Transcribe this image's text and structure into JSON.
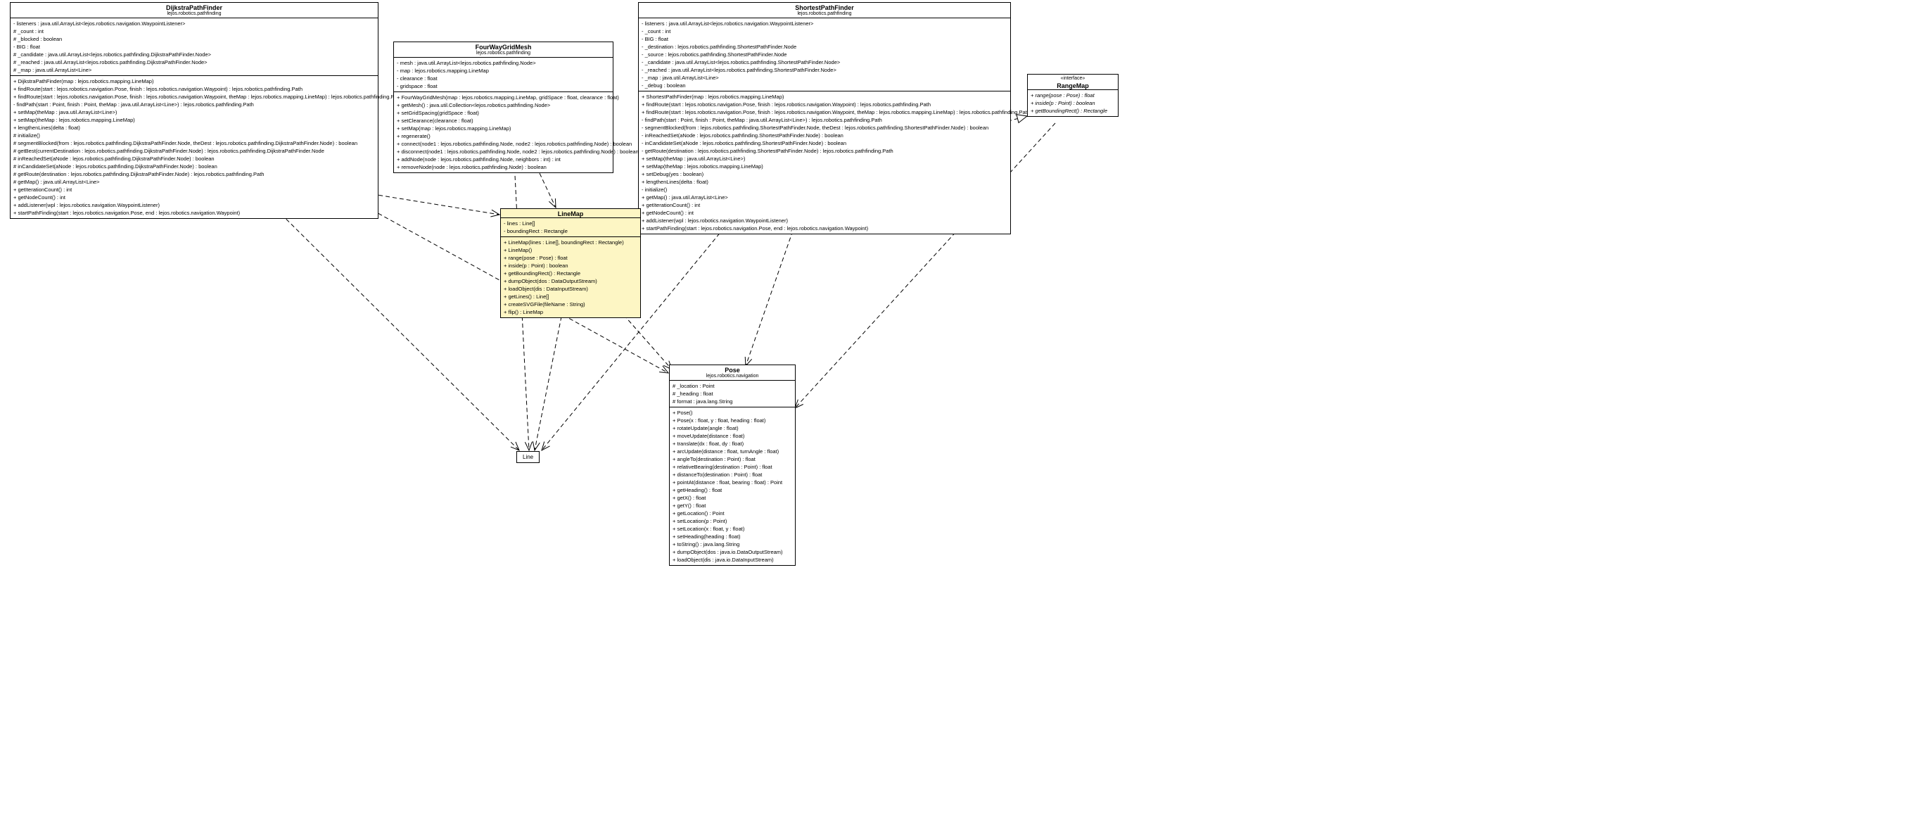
{
  "classes": {
    "dijkstra": {
      "name": "DijkstraPathFinder",
      "package": "lejos.robotics.pathfinding",
      "attrs": [
        "- listeners : java.util.ArrayList<lejos.robotics.navigation.WaypointListener>",
        "# _count : int",
        "# _blocked : boolean",
        "- BIG : float",
        "# _candidate : java.util.ArrayList<lejos.robotics.pathfinding.DijkstraPathFinder.Node>",
        "# _reached : java.util.ArrayList<lejos.robotics.pathfinding.DijkstraPathFinder.Node>",
        "# _map : java.util.ArrayList<Line>"
      ],
      "ops": [
        "+ DijkstraPathFinder(map : lejos.robotics.mapping.LineMap)",
        "+ findRoute(start : lejos.robotics.navigation.Pose, finish : lejos.robotics.navigation.Waypoint) : lejos.robotics.pathfinding.Path",
        "+ findRoute(start : lejos.robotics.navigation.Pose, finish : lejos.robotics.navigation.Waypoint, theMap : lejos.robotics.mapping.LineMap) : lejos.robotics.pathfinding.Path",
        "- findPath(start : Point, finish : Point, theMap : java.util.ArrayList<Line>) : lejos.robotics.pathfinding.Path",
        "+ setMap(theMap : java.util.ArrayList<Line>)",
        "+ setMap(theMap : lejos.robotics.mapping.LineMap)",
        "+ lengthenLines(delta : float)",
        "# initialize()",
        "# segmentBlocked(from : lejos.robotics.pathfinding.DijkstraPathFinder.Node, theDest : lejos.robotics.pathfinding.DijkstraPathFinder.Node) : boolean",
        "# getBest(currentDestination : lejos.robotics.pathfinding.DijkstraPathFinder.Node) : lejos.robotics.pathfinding.DijkstraPathFinder.Node",
        "# inReachedSet(aNode : lejos.robotics.pathfinding.DijkstraPathFinder.Node) : boolean",
        "# inCandidateSet(aNode : lejos.robotics.pathfinding.DijkstraPathFinder.Node) : boolean",
        "# getRoute(destination : lejos.robotics.pathfinding.DijkstraPathFinder.Node) : lejos.robotics.pathfinding.Path",
        "# getMap() : java.util.ArrayList<Line>",
        "+ getIterationCount() : int",
        "+ getNodeCount() : int",
        "+ addListener(wpl : lejos.robotics.navigation.WaypointListener)",
        "+ startPathFinding(start : lejos.robotics.navigation.Pose, end : lejos.robotics.navigation.Waypoint)"
      ]
    },
    "fourway": {
      "name": "FourWayGridMesh",
      "package": "lejos.robotics.pathfinding",
      "attrs": [
        "- mesh : java.util.ArrayList<lejos.robotics.pathfinding.Node>",
        "- map : lejos.robotics.mapping.LineMap",
        "- clearance : float",
        "- gridspace : float"
      ],
      "ops": [
        "+ FourWayGridMesh(map : lejos.robotics.mapping.LineMap, gridSpace : float, clearance : float)",
        "+ getMesh() : java.util.Collection<lejos.robotics.pathfinding.Node>",
        "+ setGridSpacing(gridSpace : float)",
        "+ setClearance(clearance : float)",
        "+ setMap(map : lejos.robotics.mapping.LineMap)",
        "+ regenerate()",
        "+ connect(node1 : lejos.robotics.pathfinding.Node, node2 : lejos.robotics.pathfinding.Node) : boolean",
        "+ disconnect(node1 : lejos.robotics.pathfinding.Node, node2 : lejos.robotics.pathfinding.Node) : boolean",
        "+ addNode(node : lejos.robotics.pathfinding.Node, neighbors : int) : int",
        "+ removeNode(node : lejos.robotics.pathfinding.Node) : boolean"
      ]
    },
    "shortest": {
      "name": "ShortestPathFinder",
      "package": "lejos.robotics.pathfinding",
      "attrs": [
        "- listeners : java.util.ArrayList<lejos.robotics.navigation.WaypointListener>",
        "- _count : int",
        "- BIG : float",
        "- _destination : lejos.robotics.pathfinding.ShortestPathFinder.Node",
        "- _source : lejos.robotics.pathfinding.ShortestPathFinder.Node",
        "- _candidate : java.util.ArrayList<lejos.robotics.pathfinding.ShortestPathFinder.Node>",
        "- _reached : java.util.ArrayList<lejos.robotics.pathfinding.ShortestPathFinder.Node>",
        "- _map : java.util.ArrayList<Line>",
        "- _debug : boolean"
      ],
      "ops": [
        "+ ShortestPathFinder(map : lejos.robotics.mapping.LineMap)",
        "+ findRoute(start : lejos.robotics.navigation.Pose, finish : lejos.robotics.navigation.Waypoint) : lejos.robotics.pathfinding.Path",
        "+ findRoute(start : lejos.robotics.navigation.Pose, finish : lejos.robotics.navigation.Waypoint, theMap : lejos.robotics.mapping.LineMap) : lejos.robotics.pathfinding.Path",
        "- findPath(start : Point, finish : Point, theMap : java.util.ArrayList<Line>) : lejos.robotics.pathfinding.Path",
        "- segmentBlocked(from : lejos.robotics.pathfinding.ShortestPathFinder.Node, theDest : lejos.robotics.pathfinding.ShortestPathFinder.Node) : boolean",
        "- inReachedSet(aNode : lejos.robotics.pathfinding.ShortestPathFinder.Node) : boolean",
        "- inCandidateSet(aNode : lejos.robotics.pathfinding.ShortestPathFinder.Node) : boolean",
        "- getRoute(destination : lejos.robotics.pathfinding.ShortestPathFinder.Node) : lejos.robotics.pathfinding.Path",
        "+ setMap(theMap : java.util.ArrayList<Line>)",
        "+ setMap(theMap : lejos.robotics.mapping.LineMap)",
        "+ setDebug(yes : boolean)",
        "+ lengthenLines(delta : float)",
        "- initialize()",
        "+ getMap() : java.util.ArrayList<Line>",
        "+ getIterationCount() : int",
        "+ getNodeCount() : int",
        "+ addListener(wpl : lejos.robotics.navigation.WaypointListener)",
        "+ startPathFinding(start : lejos.robotics.navigation.Pose, end : lejos.robotics.navigation.Waypoint)"
      ]
    },
    "rangemap": {
      "stereotype": "«interface»",
      "name": "RangeMap",
      "ops": [
        "+ range(pose : Pose) : float",
        "+ inside(p : Point) : boolean",
        "+ getBoundingRect() : Rectangle"
      ]
    },
    "linemap": {
      "name": "LineMap",
      "attrs": [
        "- lines : Line[]",
        "- boundingRect : Rectangle"
      ],
      "ops": [
        "+ LineMap(lines : Line[], boundingRect : Rectangle)",
        "+ LineMap()",
        "+ range(pose : Pose) : float",
        "+ inside(p : Point) : boolean",
        "+ getBoundingRect() : Rectangle",
        "+ dumpObject(dos : DataOutputStream)",
        "+ loadObject(dis : DataInputStream)",
        "+ getLines() : Line[]",
        "+ createSVGFile(fileName : String)",
        "+ flip() : LineMap"
      ]
    },
    "pose": {
      "name": "Pose",
      "package": "lejos.robotics.navigation",
      "attrs": [
        "# _location : Point",
        "# _heading : float",
        "# format : java.lang.String"
      ],
      "ops": [
        "+ Pose()",
        "+ Pose(x : float, y : float, heading : float)",
        "+ rotateUpdate(angle : float)",
        "+ moveUpdate(distance : float)",
        "+ translate(dx : float, dy : float)",
        "+ arcUpdate(distance : float, turnAngle : float)",
        "+ angleTo(destination : Point) : float",
        "+ relativeBearing(destination : Point) : float",
        "+ distanceTo(destination : Point) : float",
        "+ pointAt(distance : float, bearing : float) : Point",
        "+ getHeading() : float",
        "+ getX() : float",
        "+ getY() : float",
        "+ getLocation() : Point",
        "+ setLocation(p : Point)",
        "+ setLocation(x : float, y : float)",
        "+ setHeading(heading : float)",
        "+ toString() : java.lang.String",
        "+ dumpObject(dos : java.io.DataOutputStream)",
        "+ loadObject(dis : java.io.DataInputStream)"
      ]
    },
    "line": {
      "name": "Line"
    }
  }
}
